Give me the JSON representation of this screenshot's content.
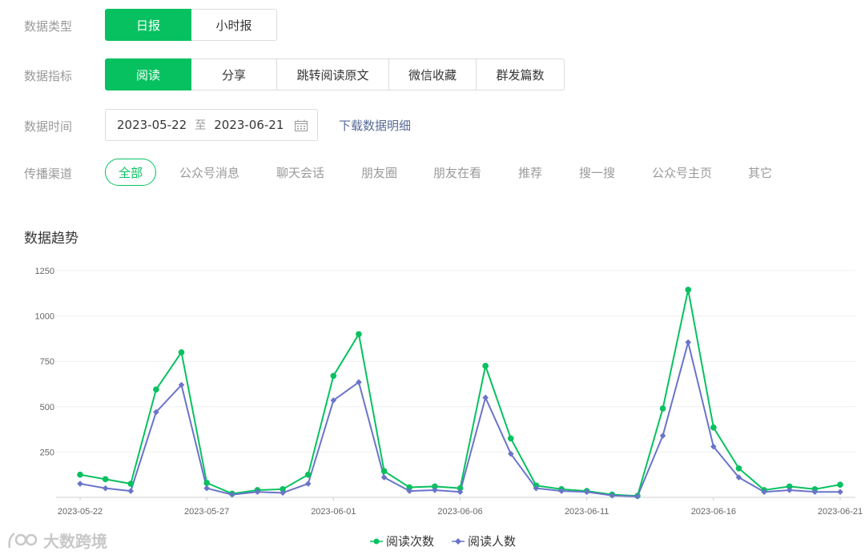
{
  "filters": {
    "data_type": {
      "label": "数据类型",
      "options": [
        {
          "label": "日报",
          "active": true
        },
        {
          "label": "小时报",
          "active": false
        }
      ]
    },
    "metric": {
      "label": "数据指标",
      "options": [
        {
          "label": "阅读",
          "active": true
        },
        {
          "label": "分享",
          "active": false
        },
        {
          "label": "跳转阅读原文",
          "active": false
        },
        {
          "label": "微信收藏",
          "active": false
        },
        {
          "label": "群发篇数",
          "active": false
        }
      ]
    },
    "time": {
      "label": "数据时间",
      "start": "2023-05-22",
      "separator": "至",
      "end": "2023-06-21",
      "download_label": "下载数据明细"
    },
    "channel": {
      "label": "传播渠道",
      "options": [
        {
          "label": "全部",
          "active": true
        },
        {
          "label": "公众号消息",
          "active": false
        },
        {
          "label": "聊天会话",
          "active": false
        },
        {
          "label": "朋友圈",
          "active": false
        },
        {
          "label": "朋友在看",
          "active": false
        },
        {
          "label": "推荐",
          "active": false
        },
        {
          "label": "搜一搜",
          "active": false
        },
        {
          "label": "公众号主页",
          "active": false
        },
        {
          "label": "其它",
          "active": false
        }
      ]
    }
  },
  "section_title": "数据趋势",
  "watermark": "大数跨境",
  "chart_data": {
    "type": "line",
    "x": [
      "2023-05-22",
      "2023-05-23",
      "2023-05-24",
      "2023-05-25",
      "2023-05-26",
      "2023-05-27",
      "2023-05-28",
      "2023-05-29",
      "2023-05-30",
      "2023-05-31",
      "2023-06-01",
      "2023-06-02",
      "2023-06-03",
      "2023-06-04",
      "2023-06-05",
      "2023-06-06",
      "2023-06-07",
      "2023-06-08",
      "2023-06-09",
      "2023-06-10",
      "2023-06-11",
      "2023-06-12",
      "2023-06-13",
      "2023-06-14",
      "2023-06-15",
      "2023-06-16",
      "2023-06-17",
      "2023-06-18",
      "2023-06-19",
      "2023-06-20",
      "2023-06-21"
    ],
    "x_tick_labels": [
      "2023-05-22",
      "2023-05-27",
      "2023-06-01",
      "2023-06-06",
      "2023-06-11",
      "2023-06-16",
      "2023-06-21"
    ],
    "y_ticks": [
      250,
      500,
      750,
      1000,
      1250
    ],
    "ylim": [
      0,
      1250
    ],
    "grid": true,
    "legend_position": "bottom",
    "series": [
      {
        "name": "阅读次数",
        "color": "#07c160",
        "marker": "circle",
        "values": [
          125,
          100,
          75,
          595,
          800,
          80,
          20,
          40,
          45,
          125,
          670,
          900,
          145,
          55,
          60,
          50,
          725,
          325,
          65,
          45,
          35,
          15,
          8,
          490,
          1145,
          385,
          160,
          40,
          60,
          45,
          70
        ]
      },
      {
        "name": "阅读人数",
        "color": "#6a74c9",
        "marker": "diamond",
        "values": [
          75,
          50,
          35,
          470,
          620,
          50,
          15,
          30,
          25,
          75,
          535,
          635,
          110,
          35,
          40,
          30,
          550,
          240,
          50,
          35,
          30,
          10,
          5,
          340,
          855,
          280,
          110,
          30,
          40,
          30,
          30
        ]
      }
    ]
  }
}
